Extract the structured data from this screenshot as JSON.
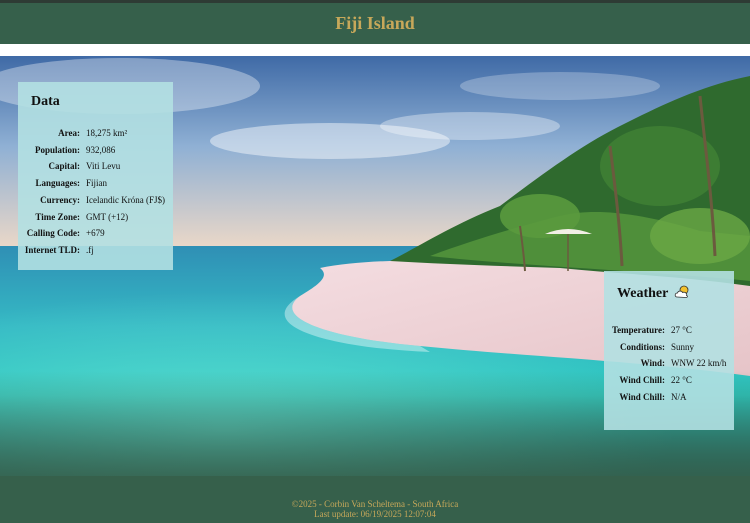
{
  "header": {
    "title": "Fiji Island"
  },
  "data_panel": {
    "title": "Data",
    "rows": [
      {
        "label": "Area:",
        "value": "18,275 km²"
      },
      {
        "label": "Population:",
        "value": "932,086"
      },
      {
        "label": "Capital:",
        "value": "Viti Levu"
      },
      {
        "label": "Languages:",
        "value": "Fijian"
      },
      {
        "label": "Currency:",
        "value": "Icelandic Króna (FJ$)"
      },
      {
        "label": "Time Zone:",
        "value": "GMT (+12)"
      },
      {
        "label": "Calling Code:",
        "value": "+679"
      },
      {
        "label": "Internet TLD:",
        "value": ".fj"
      }
    ]
  },
  "weather_panel": {
    "title": "Weather",
    "icon": "partly-cloudy-icon",
    "rows": [
      {
        "label": "Temperature:",
        "value": "27 °C"
      },
      {
        "label": "Conditions:",
        "value": "Sunny"
      },
      {
        "label": "Wind:",
        "value": "WNW 22 km/h"
      },
      {
        "label": "Wind Chill:",
        "value": "22 °C"
      },
      {
        "label": "Wind Chill:",
        "value": "N/A"
      }
    ]
  },
  "footer": {
    "copyright": "©2025 - Corbin Van Scheltema - South Africa",
    "last_update": "Last update: 06/19/2025 12:07:04"
  },
  "colors": {
    "header_bg": "#36604b",
    "accent_gold": "#c7a85a",
    "panel_bg": "#b2e0e2"
  }
}
